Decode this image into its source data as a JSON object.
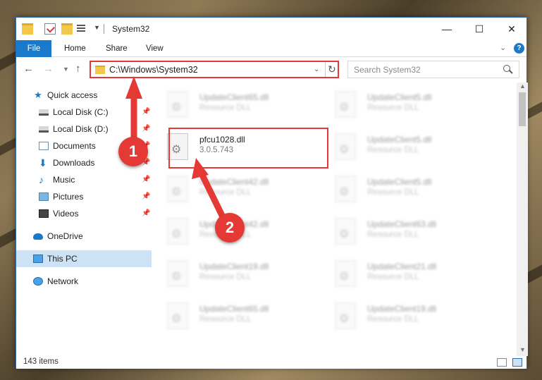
{
  "window": {
    "title": "System32",
    "controls": {
      "minimize": "—",
      "maximize": "☐",
      "close": "✕"
    }
  },
  "ribbon": {
    "tabs": [
      "File",
      "Home",
      "Share",
      "View"
    ]
  },
  "navigation": {
    "address": "C:\\Windows\\System32",
    "search_placeholder": "Search System32"
  },
  "sidebar": {
    "items": [
      {
        "label": "Quick access",
        "icon": "star-icon",
        "pinned": false
      },
      {
        "label": "Local Disk (C:)",
        "icon": "drive-icon",
        "pinned": true
      },
      {
        "label": "Local Disk (D:)",
        "icon": "drive-icon",
        "pinned": true
      },
      {
        "label": "Documents",
        "icon": "documents-icon",
        "pinned": true
      },
      {
        "label": "Downloads",
        "icon": "download-icon",
        "pinned": true
      },
      {
        "label": "Music",
        "icon": "music-icon",
        "pinned": true
      },
      {
        "label": "Pictures",
        "icon": "pictures-icon",
        "pinned": true
      },
      {
        "label": "Videos",
        "icon": "videos-icon",
        "pinned": true
      },
      {
        "label": "OneDrive",
        "icon": "cloud-icon",
        "pinned": false
      },
      {
        "label": "This PC",
        "icon": "pc-icon",
        "pinned": false,
        "selected": true
      },
      {
        "label": "Network",
        "icon": "network-icon",
        "pinned": false
      }
    ]
  },
  "files": {
    "highlighted": {
      "name": "pfcu1028.dll",
      "version": "3.0.5.743"
    },
    "left_column": [
      {
        "name": "UpdateClient65.dll",
        "sub": "Resource DLL"
      },
      {
        "name": "UpdateClient42.dll",
        "sub": "Resource DLL"
      },
      {
        "name": "UpdateClient42.dll",
        "sub": "Resource DLL"
      },
      {
        "name": "UpdateClient19.dll",
        "sub": "Resource DLL"
      },
      {
        "name": "UpdateClient65.dll",
        "sub": "Resource DLL"
      }
    ],
    "right_column": [
      {
        "name": "UpdateClient5.dll",
        "sub": "Resource DLL"
      },
      {
        "name": "UpdateClient5.dll",
        "sub": "Resource DLL"
      },
      {
        "name": "UpdateClient5.dll",
        "sub": "Resource DLL"
      },
      {
        "name": "UpdateClient63.dll",
        "sub": "Resource DLL"
      },
      {
        "name": "UpdateClient21.dll",
        "sub": "Resource DLL"
      },
      {
        "name": "UpdateClient19.dll",
        "sub": "Resource DLL"
      }
    ]
  },
  "status": {
    "item_count": "143 items"
  },
  "annotations": {
    "step1": "1",
    "step2": "2",
    "color": "#e53935"
  }
}
